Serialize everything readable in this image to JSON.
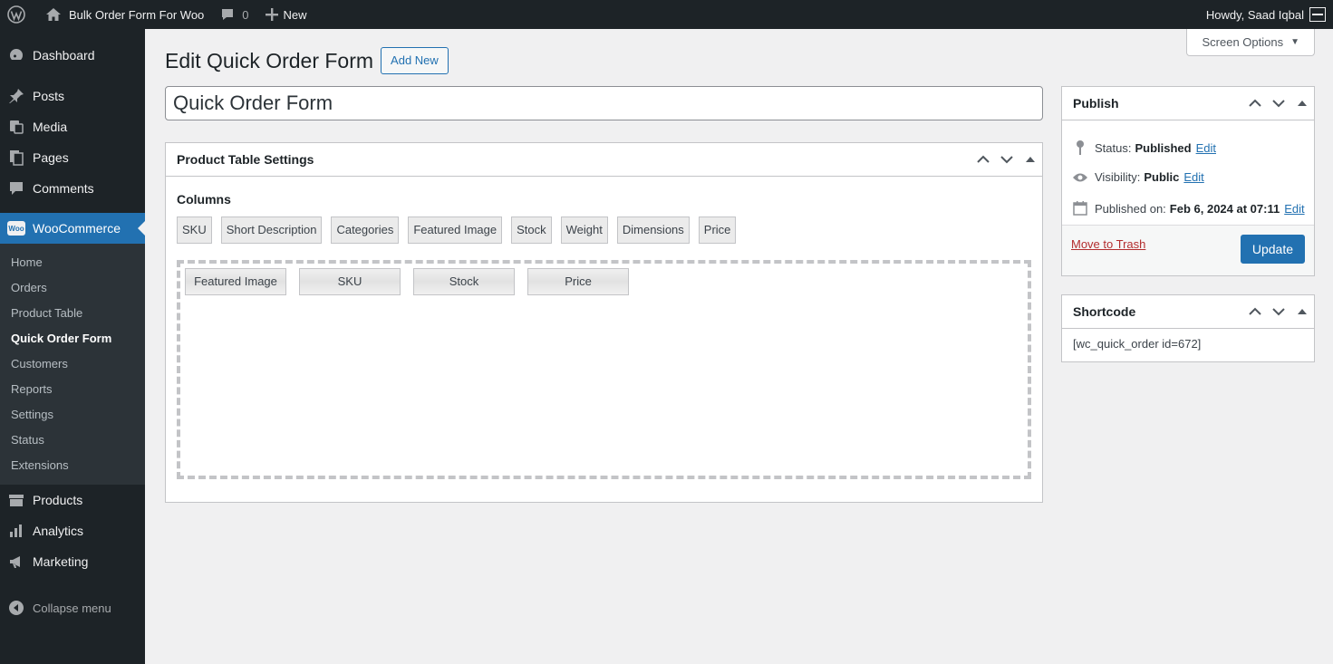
{
  "adminbar": {
    "site_name": "Bulk Order Form For Woo",
    "comments_count": "0",
    "new_label": "New",
    "greeting": "Howdy, Saad Iqbal"
  },
  "sidebar": {
    "top_items": [
      {
        "label": "Dashboard",
        "icon": "dashboard-icon"
      },
      {
        "label": "Posts",
        "icon": "pushpin-icon"
      },
      {
        "label": "Media",
        "icon": "media-icon"
      },
      {
        "label": "Pages",
        "icon": "pages-icon"
      },
      {
        "label": "Comments",
        "icon": "comment-icon"
      }
    ],
    "woocommerce": {
      "label": "WooCommerce",
      "badge": "Woo"
    },
    "woo_submenu": [
      "Home",
      "Orders",
      "Product Table",
      "Quick Order Form",
      "Customers",
      "Reports",
      "Settings",
      "Status",
      "Extensions"
    ],
    "woo_submenu_current": "Quick Order Form",
    "bottom_items": [
      {
        "label": "Products",
        "icon": "archive-icon"
      },
      {
        "label": "Analytics",
        "icon": "bar-chart-icon"
      },
      {
        "label": "Marketing",
        "icon": "megaphone-icon"
      }
    ],
    "collapse_label": "Collapse menu"
  },
  "header": {
    "screen_options": "Screen Options",
    "page_title": "Edit Quick Order Form",
    "add_new": "Add New"
  },
  "form": {
    "title_value": "Quick Order Form"
  },
  "product_table_settings": {
    "heading": "Product Table Settings",
    "columns_label": "Columns",
    "available_columns": [
      "SKU",
      "Short Description",
      "Categories",
      "Featured Image",
      "Stock",
      "Weight",
      "Dimensions",
      "Price"
    ],
    "selected_columns": [
      "Featured Image",
      "SKU",
      "Stock",
      "Price"
    ]
  },
  "publish": {
    "heading": "Publish",
    "status_label": "Status:",
    "status_value": "Published",
    "visibility_label": "Visibility:",
    "visibility_value": "Public",
    "published_on_label": "Published on:",
    "published_on_value": "Feb 6, 2024 at 07:11",
    "edit_link": "Edit",
    "trash_link": "Move to Trash",
    "update_button": "Update"
  },
  "shortcode": {
    "heading": "Shortcode",
    "value": "[wc_quick_order id=672]"
  },
  "colors": {
    "admin_dark": "#1d2327",
    "accent_blue": "#2271b1",
    "trash_red": "#b32d2e"
  }
}
